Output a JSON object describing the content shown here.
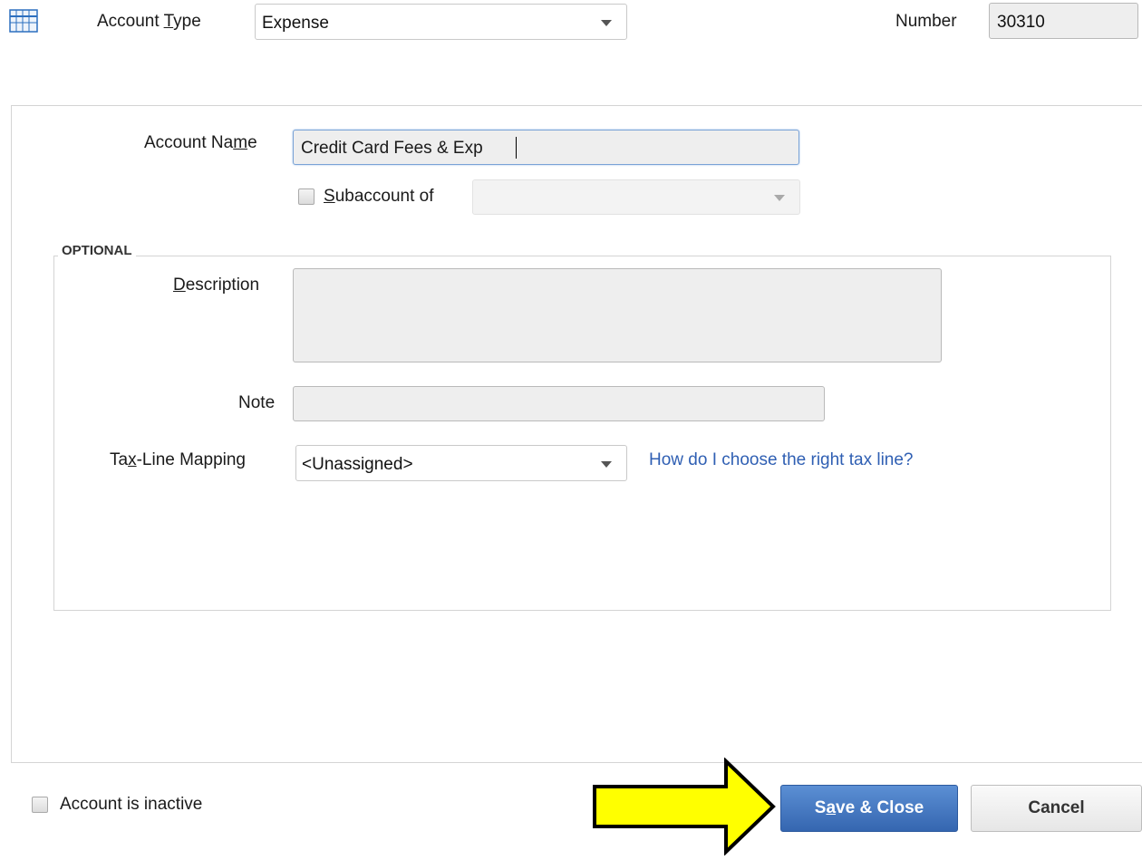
{
  "header": {
    "icon": "account-register-icon",
    "account_type_label_pre": "Account ",
    "account_type_label_key": "T",
    "account_type_label_post": "ype",
    "account_type_value": "Expense",
    "number_label": "Number",
    "number_value": "30310"
  },
  "form": {
    "account_name_label_pre": "Account Na",
    "account_name_label_key": "m",
    "account_name_label_post": "e",
    "account_name_value": "Credit Card Fees & Exp",
    "subaccount_label_key": "S",
    "subaccount_label_post": "ubaccount of",
    "subaccount_value": ""
  },
  "optional": {
    "legend": "OPTIONAL",
    "description_label_key": "D",
    "description_label_post": "escription",
    "description_value": "",
    "note_label": "Note",
    "note_value": "",
    "tax_label_pre": "Ta",
    "tax_label_key": "x",
    "tax_label_post": "-Line Mapping",
    "tax_value": "<Unassigned>",
    "tax_help_link": "How do I choose the right tax line?"
  },
  "footer": {
    "inactive_label": "Account is inactive",
    "save_label_pre": "S",
    "save_label_key": "a",
    "save_label_post": "ve & Close",
    "cancel_label": "Cancel"
  },
  "colors": {
    "primary_button": "#3f73b9",
    "link": "#2f5fb3",
    "annotation_arrow": "#ffff00"
  }
}
